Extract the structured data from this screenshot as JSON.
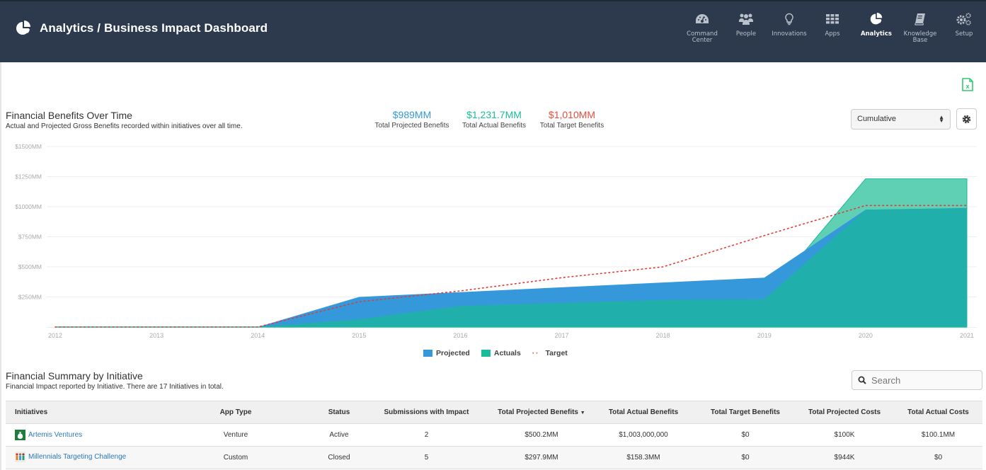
{
  "header": {
    "title": "Analytics / Business Impact Dashboard",
    "nav": [
      {
        "label": "Command Center",
        "icon": "dashboard-gauge-icon",
        "active": false
      },
      {
        "label": "People",
        "icon": "people-group-icon",
        "active": false
      },
      {
        "label": "Innovations",
        "icon": "lightbulb-icon",
        "active": false
      },
      {
        "label": "Apps",
        "icon": "apps-grid-icon",
        "active": false
      },
      {
        "label": "Analytics",
        "icon": "pie-chart-icon",
        "active": true
      },
      {
        "label": "Knowledge Base",
        "icon": "book-icon",
        "active": false
      },
      {
        "label": "Setup",
        "icon": "gears-icon",
        "active": false
      }
    ]
  },
  "export": {
    "icon": "excel-file-icon",
    "color": "#2ecc71"
  },
  "benefits": {
    "title": "Financial Benefits Over Time",
    "subtitle": "Actual and Projected Gross Benefits recorded within initiatives over all time.",
    "kpis": [
      {
        "value": "$989MM",
        "label": "Total Projected Benefits",
        "color": "#3498db"
      },
      {
        "value": "$1,231.7MM",
        "label": "Total Actual Benefits",
        "color": "#1abc9c"
      },
      {
        "value": "$1,010MM",
        "label": "Total Target Benefits",
        "color": "#e74c3c"
      }
    ],
    "mode_select": "Cumulative"
  },
  "chart_data": {
    "type": "area",
    "title": "Financial Benefits Over Time",
    "xlabel": "",
    "ylabel": "",
    "x": [
      "2012",
      "2013",
      "2014",
      "2015",
      "2016",
      "2017",
      "2018",
      "2019",
      "2020",
      "2021"
    ],
    "y_tick_labels": [
      "$250MM",
      "$500MM",
      "$750MM",
      "$1000MM",
      "$1250MM",
      "$1500MM"
    ],
    "y_ticks": [
      250,
      500,
      750,
      1000,
      1250,
      1500
    ],
    "ylim": [
      0,
      1500
    ],
    "grid": true,
    "legend_position": "bottom",
    "series": [
      {
        "name": "Projected",
        "style": "area",
        "color": "#3498db",
        "values": [
          0,
          0,
          0,
          250,
          290,
          330,
          370,
          410,
          975,
          989
        ]
      },
      {
        "name": "Actuals",
        "style": "area",
        "color": "#1abc9c",
        "values": [
          0,
          0,
          0,
          65,
          175,
          200,
          225,
          230,
          1231.7,
          1231.7
        ]
      },
      {
        "name": "Target",
        "style": "dotted-line",
        "color": "#e53935",
        "values": [
          0,
          0,
          0,
          210,
          300,
          410,
          500,
          760,
          1010,
          1010
        ]
      }
    ]
  },
  "summary": {
    "title": "Financial Summary by Initiative",
    "subtitle": "Financial Impact reported by Initiative. There are 17 Initiatives in total.",
    "search_placeholder": "Search",
    "columns": [
      "Initiatives",
      "App Type",
      "Status",
      "Submissions with Impact",
      "Total Projected Benefits",
      "Total Actual Benefits",
      "Total Target Benefits",
      "Total Projected Costs",
      "Total Actual Costs"
    ],
    "sorted_column": "Total Projected Benefits",
    "rows": [
      {
        "name": "Artemis Ventures",
        "icon": "money-bag-icon",
        "app_type": "Venture",
        "status": "Active",
        "submissions": "2",
        "proj_benefits": "$500.2MM",
        "actual_benefits": "$1,003,000,000",
        "target_benefits": "$0",
        "proj_costs": "$100K",
        "actual_costs": "$100.1MM"
      },
      {
        "name": "Millennials Targeting Challenge",
        "icon": "people-thumbnail-icon",
        "app_type": "Custom",
        "status": "Closed",
        "submissions": "5",
        "proj_benefits": "$297.9MM",
        "actual_benefits": "$158.3MM",
        "target_benefits": "$0",
        "proj_costs": "$944K",
        "actual_costs": "$0"
      }
    ]
  }
}
